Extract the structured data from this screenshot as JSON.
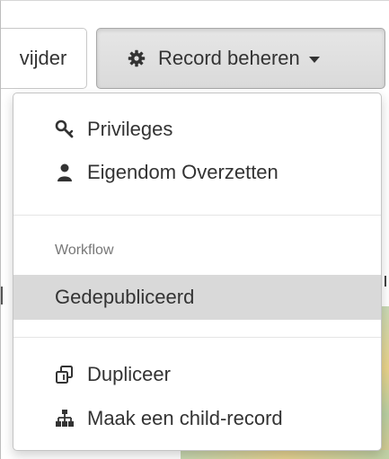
{
  "toolbar": {
    "remove_label": "vijder",
    "record_label": "Record beheren",
    "record_icon": "gear-icon",
    "caret_icon": "caret-down-icon"
  },
  "menu": {
    "items_top": [
      {
        "label": "Privileges",
        "icon": "key-icon"
      },
      {
        "label": "Eigendom Overzetten",
        "icon": "user-icon"
      }
    ],
    "section_header": "Workflow",
    "workflow_item": {
      "label": "Gedepubliceerd"
    },
    "items_bottom": [
      {
        "label": "Dupliceer",
        "icon": "copy-icon"
      },
      {
        "label": "Maak een child-record",
        "icon": "sitemap-icon"
      }
    ]
  },
  "colors": {
    "text": "#333333",
    "muted": "#777777",
    "active_bg": "#d9d9d9",
    "button_bg": "#e0e0e0"
  }
}
